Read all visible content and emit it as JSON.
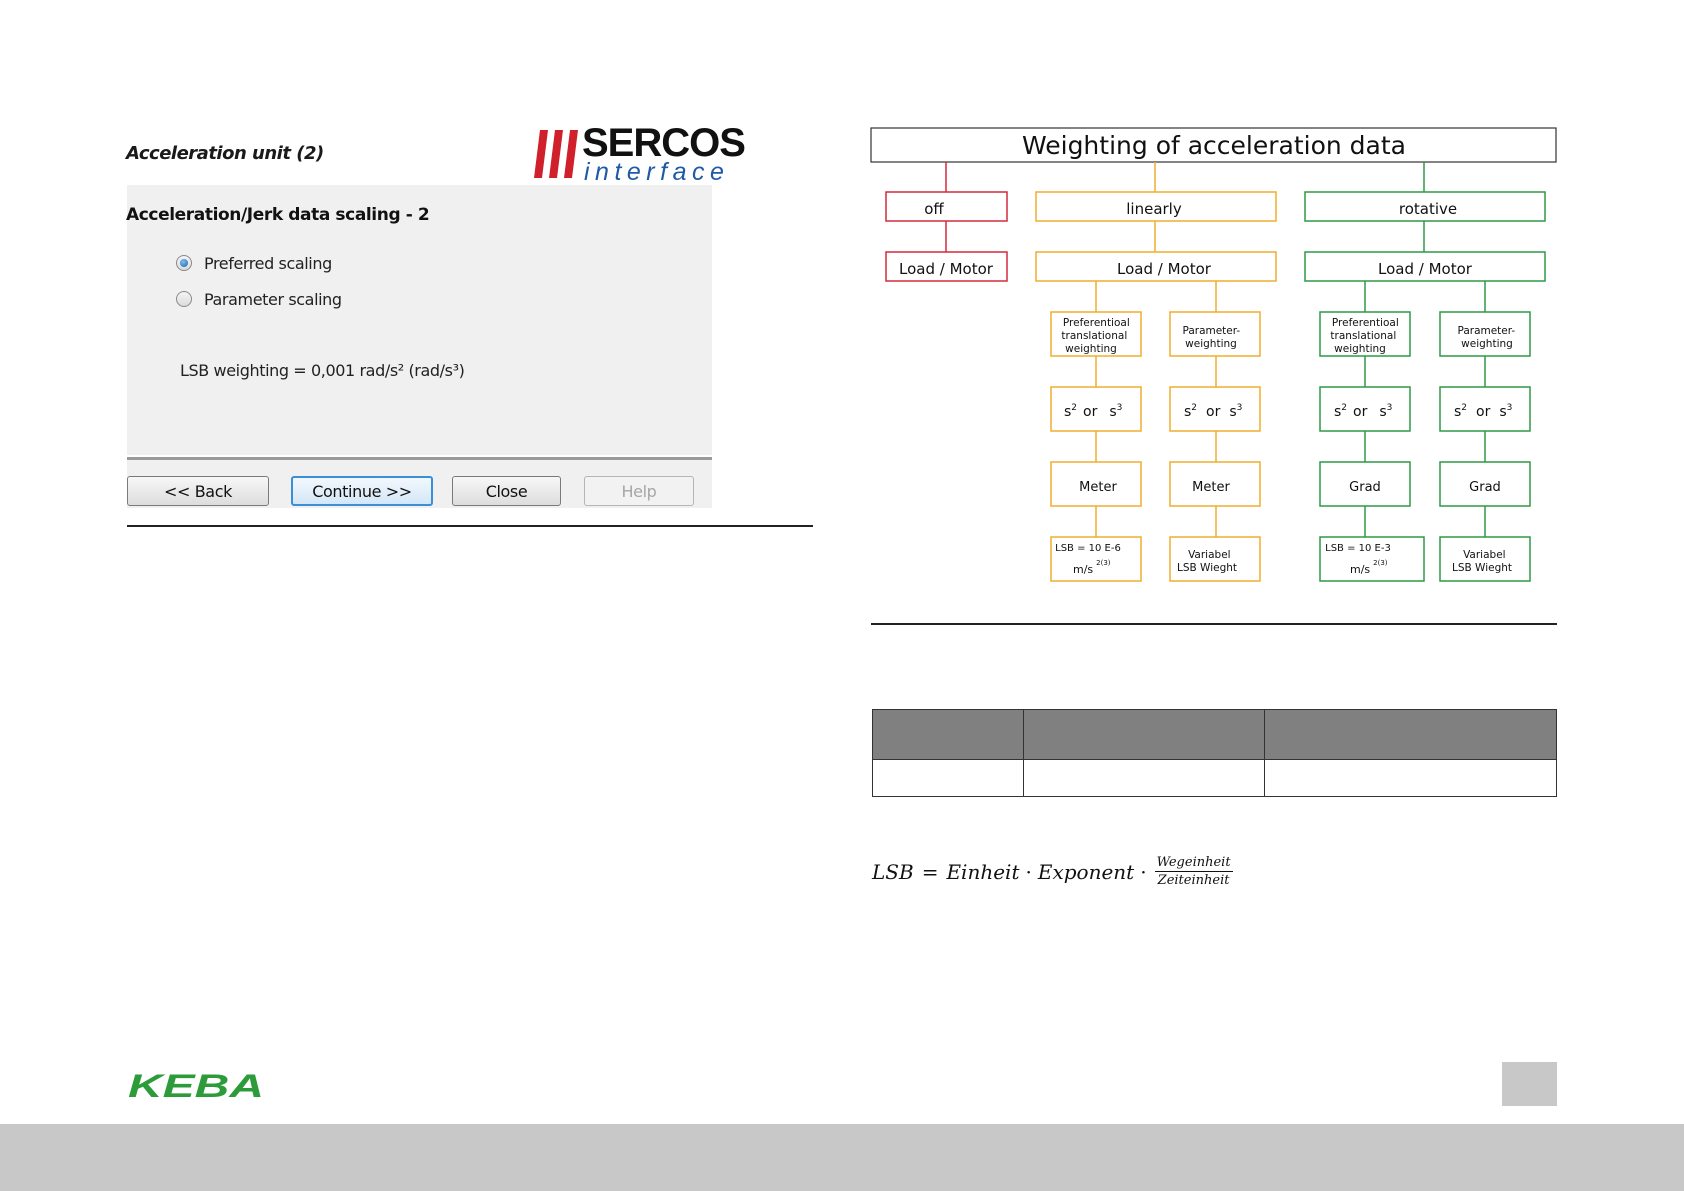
{
  "wizard": {
    "title": "Acceleration unit (2)",
    "logo": {
      "word": "SERCOS",
      "sub": "interface",
      "bar_color": "#d0202b",
      "sub_color": "#1f5aa6"
    },
    "heading": "Acceleration/Jerk data scaling - 2",
    "options": [
      {
        "label": "Preferred scaling",
        "selected": true
      },
      {
        "label": "Parameter scaling",
        "selected": false
      }
    ],
    "lsb_text": "LSB weighting = 0,001 rad/s² (rad/s³)",
    "buttons": {
      "back": "<< Back",
      "continue": "Continue >>",
      "close": "Close",
      "help": "Help"
    }
  },
  "diagram": {
    "title": "Weighting of acceleration data",
    "colors": {
      "off": "#d42a3a",
      "linear": "#f0ad2e",
      "rotative": "#2f9a45"
    },
    "off": {
      "label": "off",
      "sub": "Load / Motor"
    },
    "linear": {
      "label": "linearly",
      "sub": "Load / Motor",
      "left": [
        "Preferentioal",
        "translational",
        "weighting"
      ],
      "right": [
        "Parameter-",
        "weighting"
      ],
      "exponent": {
        "s": "s",
        "two": "2",
        "or": "or",
        "three": "3"
      },
      "unit": "Meter",
      "lsb_left": {
        "line1": "LSB = 10 E-6",
        "unit": "m/s",
        "sup": "2(3)"
      },
      "lsb_right": [
        "Variabel",
        "LSB Wieght"
      ]
    },
    "rotative": {
      "label": "rotative",
      "sub": "Load / Motor",
      "left": [
        "Preferentioal",
        "translational",
        "weighting"
      ],
      "right": [
        "Parameter-",
        "weighting"
      ],
      "exponent": {
        "s": "s",
        "two": "2",
        "or": "or",
        "three": "3"
      },
      "unit": "Grad",
      "lsb_left": {
        "line1": "LSB = 10 E-3",
        "unit": "m/s",
        "sup": "2(3)"
      },
      "lsb_right": [
        "Variabel",
        "LSB Wieght"
      ]
    }
  },
  "formula": {
    "lhs": "LSB",
    "eq": "=",
    "t1": "Einheit",
    "dot": "·",
    "t2": "Exponent",
    "num": "Wegeinheit",
    "den": "Zeiteinheit"
  },
  "footer": {
    "logo": "KEBA",
    "logo_color": "#2e9b3a"
  }
}
